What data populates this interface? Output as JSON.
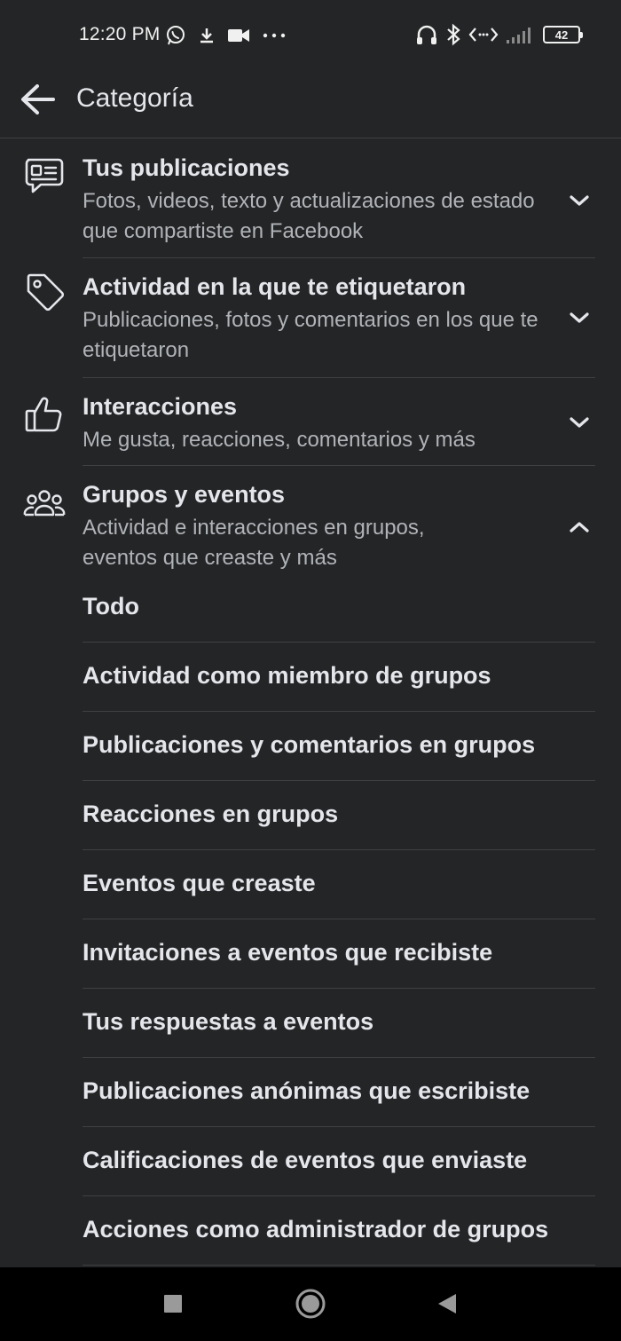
{
  "status_bar": {
    "time": "12:20 PM",
    "left_icons": [
      "whatsapp-icon",
      "download-icon",
      "video-icon",
      "more-dots-icon"
    ],
    "right_icons": [
      "headphones-icon",
      "bluetooth-icon",
      "data-sync-icon",
      "signal-icon"
    ],
    "battery": "42"
  },
  "header": {
    "title": "Categoría"
  },
  "categories": [
    {
      "title": "Tus publicaciones",
      "description": "Fotos, videos, texto y actualizaciones de estado que compartiste en Facebook",
      "icon": "posts-icon",
      "expanded": false
    },
    {
      "title": "Actividad en la que te etiquetaron",
      "description": "Publicaciones, fotos y comentarios en los que te etiquetaron",
      "icon": "tag-icon",
      "expanded": false
    },
    {
      "title": "Interacciones",
      "description": "Me gusta, reacciones, comentarios y más",
      "icon": "thumbs-up-icon",
      "expanded": false
    },
    {
      "title": "Grupos y eventos",
      "description": "Actividad e interacciones en grupos, eventos que creaste y más",
      "icon": "groups-icon",
      "expanded": true,
      "sub_items": [
        "Todo",
        "Actividad como miembro de grupos",
        "Publicaciones y comentarios en grupos",
        "Reacciones en grupos",
        "Eventos que creaste",
        "Invitaciones a eventos que recibiste",
        "Tus respuestas a eventos",
        "Publicaciones anónimas que escribiste",
        "Calificaciones de eventos que enviaste",
        "Acciones como administrador de grupos"
      ]
    }
  ],
  "nav_bar": {
    "buttons": [
      "recents-square-icon",
      "home-circle-icon",
      "back-triangle-icon"
    ]
  },
  "colors": {
    "background": "#242526",
    "primary_text": "#e4e6eb",
    "secondary_text": "#b0b3b8",
    "divider": "#3e4042",
    "nav_bar": "#000000"
  }
}
